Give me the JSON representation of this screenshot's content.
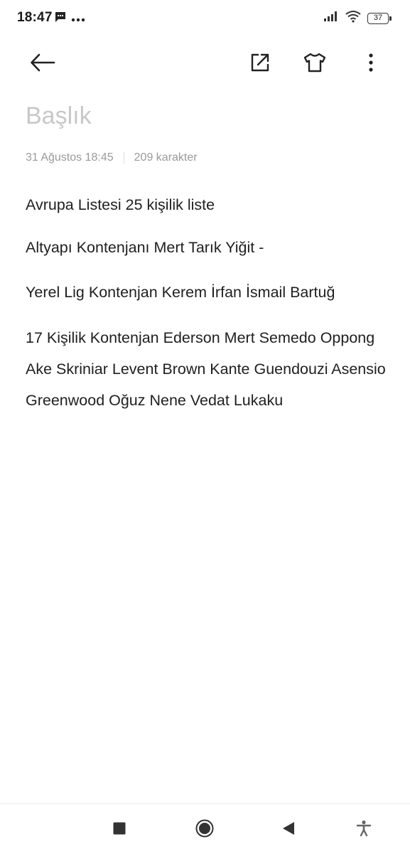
{
  "status_bar": {
    "time": "18:47",
    "battery": "37",
    "icons": [
      "message-icon",
      "more-dots-icon",
      "signal-icon",
      "wifi-icon",
      "battery-icon"
    ]
  },
  "toolbar": {
    "icons": [
      "back-arrow-icon",
      "share-icon",
      "tshirt-icon",
      "more-vert-icon"
    ]
  },
  "note": {
    "title_placeholder": "Başlık",
    "date": "31 Ağustos 18:45",
    "char_count": "209 karakter",
    "paragraphs": [
      "Avrupa Listesi 25 kişilik liste",
      "Altyapı Kontenjanı Mert Tarık Yiğit -",
      "Yerel Lig Kontenjan Kerem İrfan İsmail Bartuğ",
      "17 Kişilik Kontenjan Ederson Mert Semedo Oppong Ake Skriniar Levent Brown Kante Guendouzi Asensio Greenwood Oğuz Nene Vedat Lukaku"
    ]
  },
  "nav_bar": {
    "icons": [
      "recents-square-icon",
      "home-circle-icon",
      "back-triangle-icon",
      "accessibility-icon"
    ]
  }
}
